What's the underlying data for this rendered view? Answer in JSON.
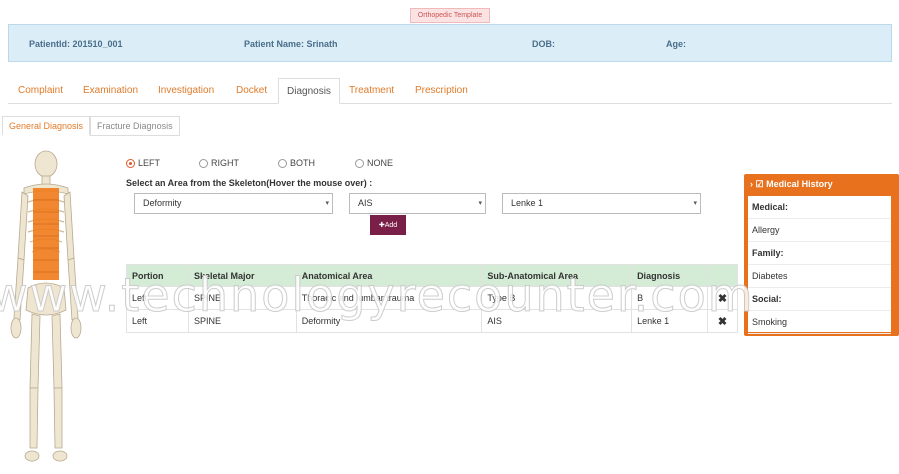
{
  "template_badge": "Orthopedic Template",
  "patient": {
    "id_label": "PatientId: 201510_001",
    "name_label": "Patient Name: Srinath",
    "dob_label": "DOB:",
    "age_label": "Age:"
  },
  "tabs": [
    {
      "label": "Complaint"
    },
    {
      "label": "Examination"
    },
    {
      "label": "Investigation"
    },
    {
      "label": "Docket"
    },
    {
      "label": "Diagnosis",
      "active": true
    },
    {
      "label": "Treatment"
    },
    {
      "label": "Prescription"
    }
  ],
  "subtabs": [
    {
      "label": "General Diagnosis",
      "active": true
    },
    {
      "label": "Fracture Diagnosis"
    }
  ],
  "side_options": [
    {
      "label": "LEFT",
      "checked": true
    },
    {
      "label": "RIGHT"
    },
    {
      "label": "BOTH"
    },
    {
      "label": "NONE"
    }
  ],
  "instruction": "Select an Area from the Skeleton(Hover the mouse over) :",
  "selects": {
    "anatomical": "Deformity",
    "sub_anatomical": "AIS",
    "diagnosis": "Lenke 1"
  },
  "add_button": "✚Add",
  "table": {
    "headers": [
      "Portion",
      "Skeletal Major",
      "Anatomical Area",
      "Sub-Anatomical Area",
      "Diagnosis",
      ""
    ],
    "rows": [
      [
        "Left",
        "SPINE",
        "Thoracic and lumbar trauma",
        "Type B",
        "B",
        "✖"
      ],
      [
        "Left",
        "SPINE",
        "Deformity",
        "AIS",
        "Lenke 1",
        "✖"
      ]
    ]
  },
  "medical_history": {
    "title": "Medical History",
    "items": [
      {
        "text": "Medical:",
        "label": true
      },
      {
        "text": "Allergy"
      },
      {
        "text": "Family:",
        "label": true
      },
      {
        "text": "Diabetes"
      },
      {
        "text": "Social:",
        "label": true
      },
      {
        "text": "Smoking"
      }
    ]
  },
  "watermark": "www.technologyrecounter.com",
  "colors": {
    "accent": "#e07b2a",
    "panel": "#e8711e",
    "add_button": "#7a2048",
    "table_header": "#d4ecd6",
    "patient_bar": "#dbeef8"
  }
}
